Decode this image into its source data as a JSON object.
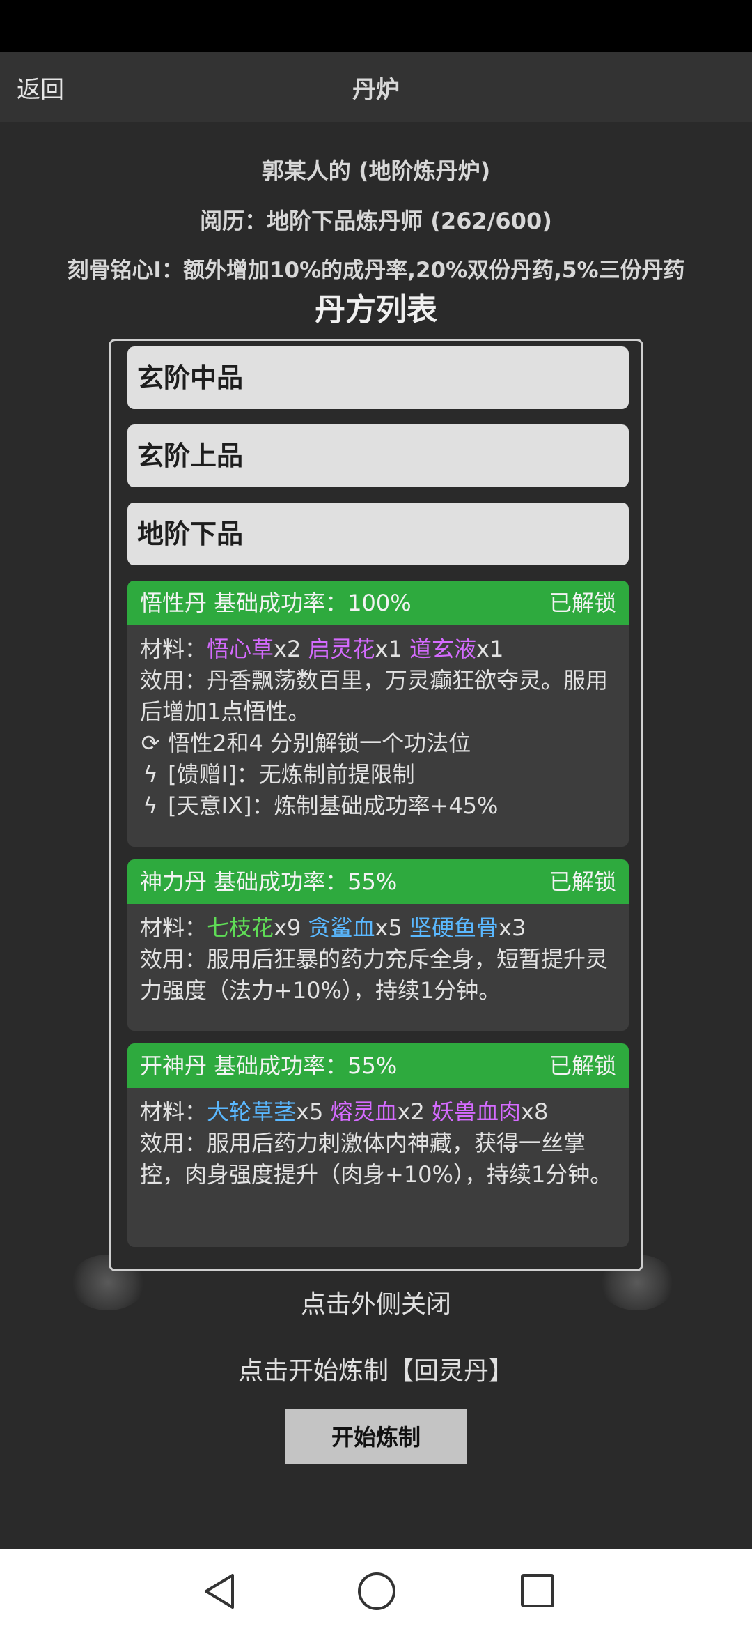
{
  "topbar": {
    "back_label": "返回",
    "title": "丹炉"
  },
  "info": {
    "furnace": "郭某人的 (地阶炼丹炉)",
    "experience": "阅历：地阶下品炼丹师 (262/600)",
    "bonus": "刻骨铭心I：额外增加10%的成丹率,20%双份丹药,5%三份丹药"
  },
  "list_title": "丹方列表",
  "categories": [
    "玄阶中品",
    "玄阶上品",
    "地阶下品"
  ],
  "recipes": [
    {
      "name": "悟性丹 基础成功率：100%",
      "status": "已解锁",
      "materials_label": "材料：",
      "materials": [
        {
          "name": "悟心草",
          "qty": "x2"
        },
        {
          "name": "启灵花",
          "qty": "x1"
        },
        {
          "name": "道玄液",
          "qty": "x1"
        }
      ],
      "effect": "效用：丹香飘荡数百里，万灵癫狂欲夺灵。服用后增加1点悟性。",
      "notes": [
        {
          "icon": "refresh-icon",
          "text": "悟性2和4 分别解锁一个功法位"
        },
        {
          "icon": "lightning-icon",
          "text": "[馈赠I]：无炼制前提限制"
        },
        {
          "icon": "lightning-icon",
          "text": "[天意IX]：炼制基础成功率+45%"
        }
      ]
    },
    {
      "name": "神力丹 基础成功率：55%",
      "status": "已解锁",
      "materials_label": "材料：",
      "materials": [
        {
          "name": "七枝花",
          "qty": "x9"
        },
        {
          "name": "贪鲨血",
          "qty": "x5"
        },
        {
          "name": "坚硬鱼骨",
          "qty": "x3"
        }
      ],
      "effect": "效用：服用后狂暴的药力充斥全身，短暂提升灵力强度（法力+10%），持续1分钟。",
      "notes": []
    },
    {
      "name": "开神丹 基础成功率：55%",
      "status": "已解锁",
      "materials_label": "材料：",
      "materials": [
        {
          "name": "大轮草茎",
          "qty": "x5"
        },
        {
          "name": "熔灵血",
          "qty": "x2"
        },
        {
          "name": "妖兽血肉",
          "qty": "x8"
        }
      ],
      "effect": "效用：服用后药力刺激体内神藏，获得一丝掌控，肉身强度提升（肉身+10%），持续1分钟。",
      "notes": []
    }
  ],
  "close_hint": "点击外侧关闭",
  "start_hint": "点击开始炼制【回灵丹】",
  "start_button": "开始炼制",
  "colors": {
    "header_green": "#2eaa3e",
    "material_purple": "#d56bff",
    "material_green": "#5fdc56",
    "material_blue": "#5ab8ff"
  }
}
